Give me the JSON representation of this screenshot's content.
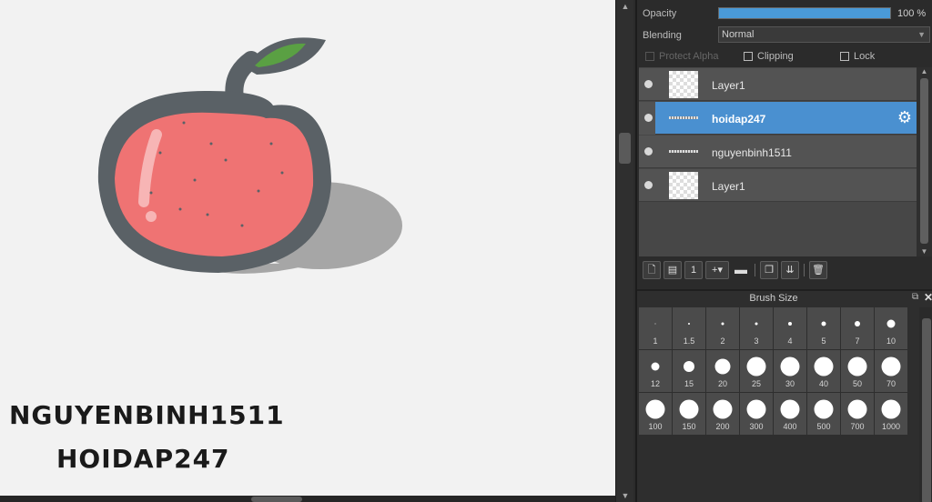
{
  "canvas": {
    "text_lines": [
      "NGUYENBINH1511",
      "HOIDAP247"
    ]
  },
  "layer_props": {
    "opacity_label": "Opacity",
    "opacity_value": "100 %",
    "opacity_fraction": 1.0,
    "blending_label": "Blending",
    "blending_value": "Normal",
    "protect_alpha_label": "Protect Alpha",
    "clipping_label": "Clipping",
    "lock_label": "Lock"
  },
  "layers": [
    {
      "name": "Layer1",
      "thumb": "transparent",
      "selected": false
    },
    {
      "name": "hoidap247",
      "thumb": "text",
      "selected": true
    },
    {
      "name": "nguyenbinh1511",
      "thumb": "text",
      "selected": false
    },
    {
      "name": "Layer1",
      "thumb": "transparent",
      "selected": false
    }
  ],
  "layer_toolbar_icons": [
    "new-layer-icon",
    "new-halftone-layer-icon",
    "new-1bit-layer-icon",
    "add-layer-dropdown-icon",
    "folder-icon",
    "duplicate-layer-icon",
    "merge-layer-icon",
    "delete-layer-icon"
  ],
  "brush_panel": {
    "title": "Brush Size",
    "sizes": [
      "1",
      "1.5",
      "2",
      "3",
      "4",
      "5",
      "7",
      "10",
      "12",
      "15",
      "20",
      "25",
      "30",
      "40",
      "50",
      "70",
      "100",
      "150",
      "200",
      "300",
      "400",
      "500",
      "700",
      "1000"
    ]
  },
  "colors": {
    "accent": "#4a90d0",
    "apple_body": "#ef7373",
    "apple_outline": "#5a6166",
    "leaf": "#5aa043",
    "shadow": "#a6a6a6"
  }
}
